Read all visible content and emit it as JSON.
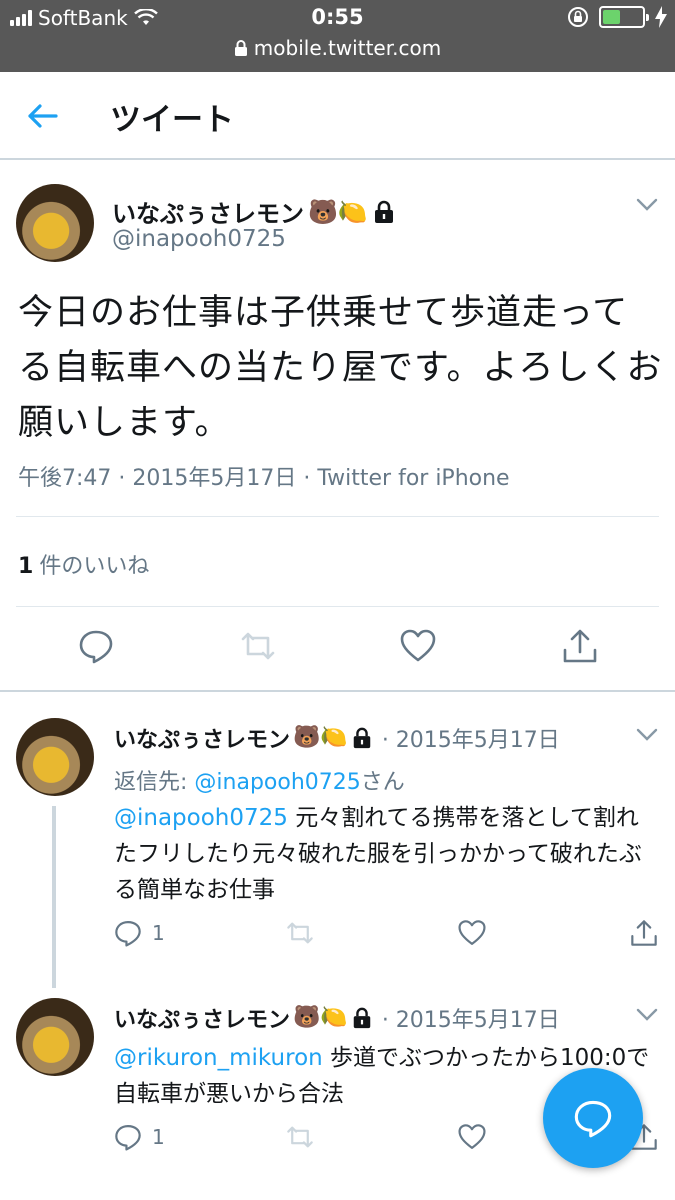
{
  "status_bar": {
    "carrier": "SoftBank",
    "time": "0:55",
    "url": "mobile.twitter.com"
  },
  "header": {
    "title": "ツイート"
  },
  "main_tweet": {
    "name": "いなぷぅさレモン",
    "emoji": "🐻🍋",
    "handle": "@inapooh0725",
    "text": "今日のお仕事は子供乗せて歩道走ってる自転車への当たり屋です。よろしくお願いします。",
    "meta": "午後7:47 · 2015年5月17日 · Twitter for iPhone",
    "likes_count": "1",
    "likes_label": "件のいいね"
  },
  "replies": [
    {
      "name": "いなぷぅさレモン",
      "emoji": "🐻🍋",
      "date": "· 2015年5月17日",
      "replying_prefix": "返信先: ",
      "replying_handle": "@inapooh0725",
      "replying_suffix": "さん",
      "mention": "@inapooh0725",
      "text": " 元々割れてる携帯を落として割れたフリしたり元々破れた服を引っかかって破れたぶる簡単なお仕事",
      "reply_count": "1"
    },
    {
      "name": "いなぷぅさレモン",
      "emoji": "🐻🍋",
      "date": "· 2015年5月17日",
      "mention": "@rikuron_mikuron",
      "text": " 歩道でぶつかったから100:0で自転車が悪いから合法",
      "reply_count": "1"
    }
  ],
  "colors": {
    "accent": "#1da1f2",
    "muted": "#657786",
    "status_bar": "#585858"
  },
  "icons": [
    "back-arrow-icon",
    "lock-icon",
    "chevron-down-icon",
    "reply-icon",
    "retweet-icon",
    "like-icon",
    "share-icon",
    "compose-icon"
  ]
}
